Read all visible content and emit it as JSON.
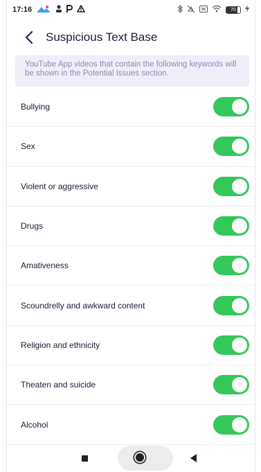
{
  "status_bar": {
    "time": "17:16",
    "left_icons": [
      "app-logo-icon",
      "person-icon",
      "p-icon",
      "warning-icon"
    ],
    "right_icons": [
      "bluetooth-icon",
      "mute-icon",
      "sim-icon",
      "wifi-icon",
      "battery-icon",
      "charging-icon"
    ],
    "battery_text": "70"
  },
  "header": {
    "title": "Suspicious Text Base"
  },
  "notice": {
    "text": "YouTube App videos that contain the following keywords will be shown in the Potential Issues section."
  },
  "colors": {
    "toggle_on": "#34c75a",
    "notice_bg": "#efedf7",
    "notice_text": "#8f89b4",
    "title_text": "#1d1a35"
  },
  "keywords": [
    {
      "label": "Bullying",
      "enabled": true
    },
    {
      "label": "Sex",
      "enabled": true
    },
    {
      "label": "Violent or aggressive",
      "enabled": true
    },
    {
      "label": "Drugs",
      "enabled": true
    },
    {
      "label": "Amativeness",
      "enabled": true
    },
    {
      "label": "Scoundrelly and awkward content",
      "enabled": true
    },
    {
      "label": "Religion and ethnicity",
      "enabled": true
    },
    {
      "label": "Theaten and suicide",
      "enabled": true
    },
    {
      "label": "Alcohol",
      "enabled": true
    }
  ],
  "nav_bar": {
    "buttons": [
      "recent-apps-icon",
      "home-icon",
      "back-icon"
    ]
  }
}
